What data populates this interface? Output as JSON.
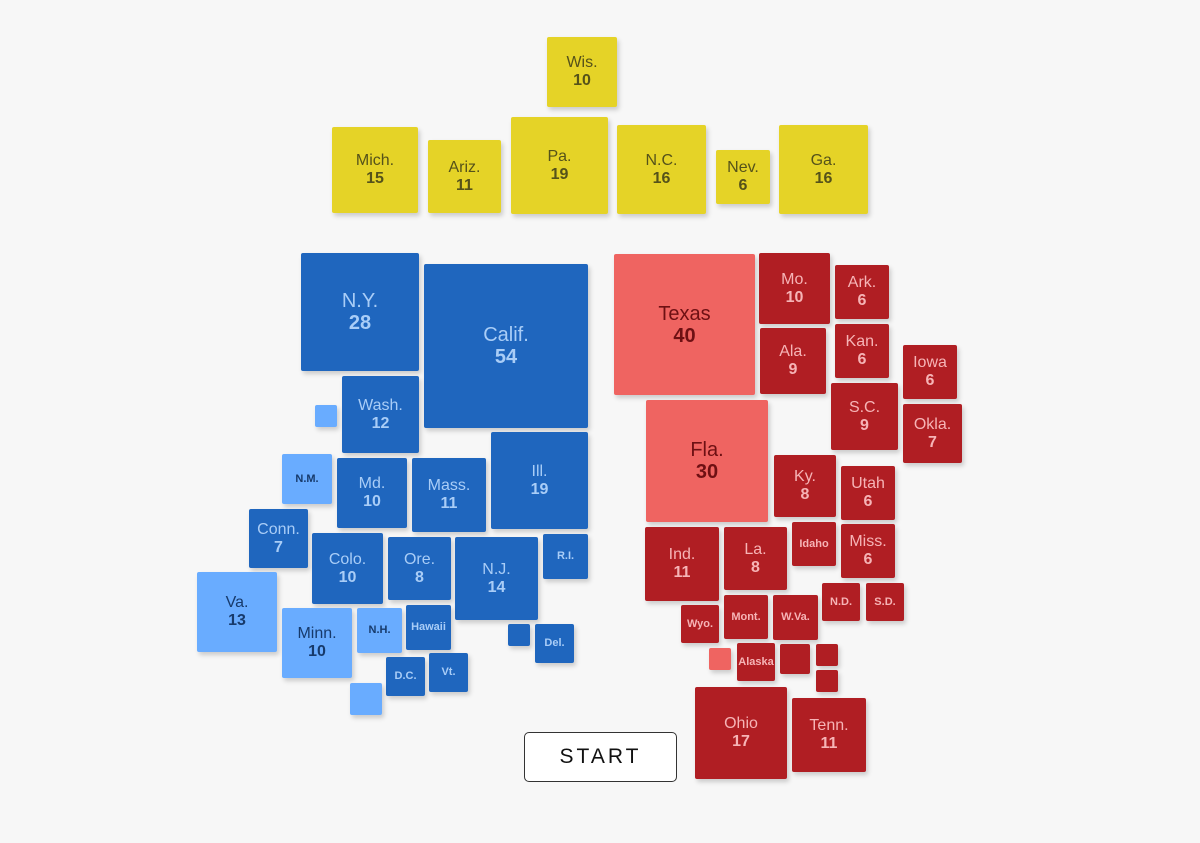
{
  "colors": {
    "toss-up": "#e5d327",
    "dem": "#1f66be",
    "lean-dem": "#69acff",
    "rep": "#b01e23",
    "lean-rep": "#ef6461"
  },
  "states": [
    {
      "name": "Wis.",
      "votes": "10",
      "group": "toss"
    },
    {
      "name": "Mich.",
      "votes": "15",
      "group": "toss"
    },
    {
      "name": "Ariz.",
      "votes": "11",
      "group": "toss"
    },
    {
      "name": "Pa.",
      "votes": "19",
      "group": "toss"
    },
    {
      "name": "N.C.",
      "votes": "16",
      "group": "toss"
    },
    {
      "name": "Nev.",
      "votes": "6",
      "group": "toss"
    },
    {
      "name": "Ga.",
      "votes": "16",
      "group": "toss"
    },
    {
      "name": "N.Y.",
      "votes": "28",
      "group": "dem"
    },
    {
      "name": "Calif.",
      "votes": "54",
      "group": "dem"
    },
    {
      "name": "",
      "votes": "",
      "group": "leandem"
    },
    {
      "name": "Wash.",
      "votes": "12",
      "group": "dem"
    },
    {
      "name": "N.M.",
      "votes": "",
      "group": "leandem"
    },
    {
      "name": "Md.",
      "votes": "10",
      "group": "dem"
    },
    {
      "name": "Mass.",
      "votes": "11",
      "group": "dem"
    },
    {
      "name": "Ill.",
      "votes": "19",
      "group": "dem"
    },
    {
      "name": "Conn.",
      "votes": "7",
      "group": "dem"
    },
    {
      "name": "Colo.",
      "votes": "10",
      "group": "dem"
    },
    {
      "name": "Ore.",
      "votes": "8",
      "group": "dem"
    },
    {
      "name": "N.J.",
      "votes": "14",
      "group": "dem"
    },
    {
      "name": "R.I.",
      "votes": "",
      "group": "dem"
    },
    {
      "name": "Va.",
      "votes": "13",
      "group": "leandem"
    },
    {
      "name": "Minn.",
      "votes": "10",
      "group": "leandem"
    },
    {
      "name": "N.H.",
      "votes": "",
      "group": "leandem"
    },
    {
      "name": "Hawaii",
      "votes": "",
      "group": "dem"
    },
    {
      "name": "",
      "votes": "",
      "group": "dem"
    },
    {
      "name": "Del.",
      "votes": "",
      "group": "dem"
    },
    {
      "name": "D.C.",
      "votes": "",
      "group": "dem"
    },
    {
      "name": "Vt.",
      "votes": "",
      "group": "dem"
    },
    {
      "name": "",
      "votes": "",
      "group": "leandem"
    },
    {
      "name": "Texas",
      "votes": "40",
      "group": "leanrep"
    },
    {
      "name": "Mo.",
      "votes": "10",
      "group": "rep"
    },
    {
      "name": "Ark.",
      "votes": "6",
      "group": "rep"
    },
    {
      "name": "Ala.",
      "votes": "9",
      "group": "rep"
    },
    {
      "name": "Kan.",
      "votes": "6",
      "group": "rep"
    },
    {
      "name": "Iowa",
      "votes": "6",
      "group": "rep"
    },
    {
      "name": "S.C.",
      "votes": "9",
      "group": "rep"
    },
    {
      "name": "Okla.",
      "votes": "7",
      "group": "rep"
    },
    {
      "name": "Fla.",
      "votes": "30",
      "group": "leanrep"
    },
    {
      "name": "Ky.",
      "votes": "8",
      "group": "rep"
    },
    {
      "name": "Utah",
      "votes": "6",
      "group": "rep"
    },
    {
      "name": "Ind.",
      "votes": "11",
      "group": "rep"
    },
    {
      "name": "La.",
      "votes": "8",
      "group": "rep"
    },
    {
      "name": "Idaho",
      "votes": "",
      "group": "rep"
    },
    {
      "name": "Miss.",
      "votes": "6",
      "group": "rep"
    },
    {
      "name": "N.D.",
      "votes": "",
      "group": "rep"
    },
    {
      "name": "S.D.",
      "votes": "",
      "group": "rep"
    },
    {
      "name": "Wyo.",
      "votes": "",
      "group": "rep"
    },
    {
      "name": "Mont.",
      "votes": "",
      "group": "rep"
    },
    {
      "name": "W.Va.",
      "votes": "",
      "group": "rep"
    },
    {
      "name": "",
      "votes": "",
      "group": "leanrep"
    },
    {
      "name": "Alaska",
      "votes": "",
      "group": "rep"
    },
    {
      "name": "",
      "votes": "",
      "group": "rep"
    },
    {
      "name": "",
      "votes": "",
      "group": "rep"
    },
    {
      "name": "",
      "votes": "",
      "group": "rep"
    },
    {
      "name": "Ohio",
      "votes": "17",
      "group": "rep"
    },
    {
      "name": "Tenn.",
      "votes": "11",
      "group": "rep"
    }
  ],
  "start_label": "START"
}
